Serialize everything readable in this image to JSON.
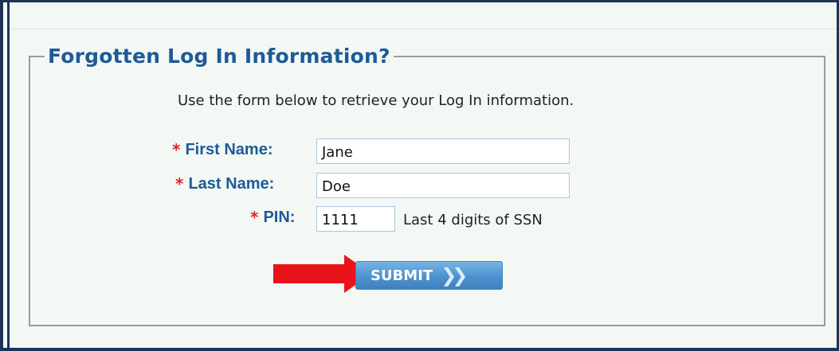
{
  "form": {
    "title": "Forgotten Log In Information?",
    "instructions": "Use the form below to retrieve your Log In information.",
    "required_marker": "*",
    "fields": {
      "first_name": {
        "label": "First Name:",
        "value": "Jane"
      },
      "last_name": {
        "label": "Last Name:",
        "value": "Doe"
      },
      "pin": {
        "label": "PIN:",
        "value": "1111",
        "hint": "Last 4 digits of SSN"
      }
    },
    "submit_label": "SUBMIT",
    "submit_icon": "double-chevron-right-icon"
  },
  "colors": {
    "frame": "#1c3557",
    "label": "#1e5a97",
    "required": "#e02424",
    "arrow": "#e8141a",
    "button": "#4c91cf"
  }
}
